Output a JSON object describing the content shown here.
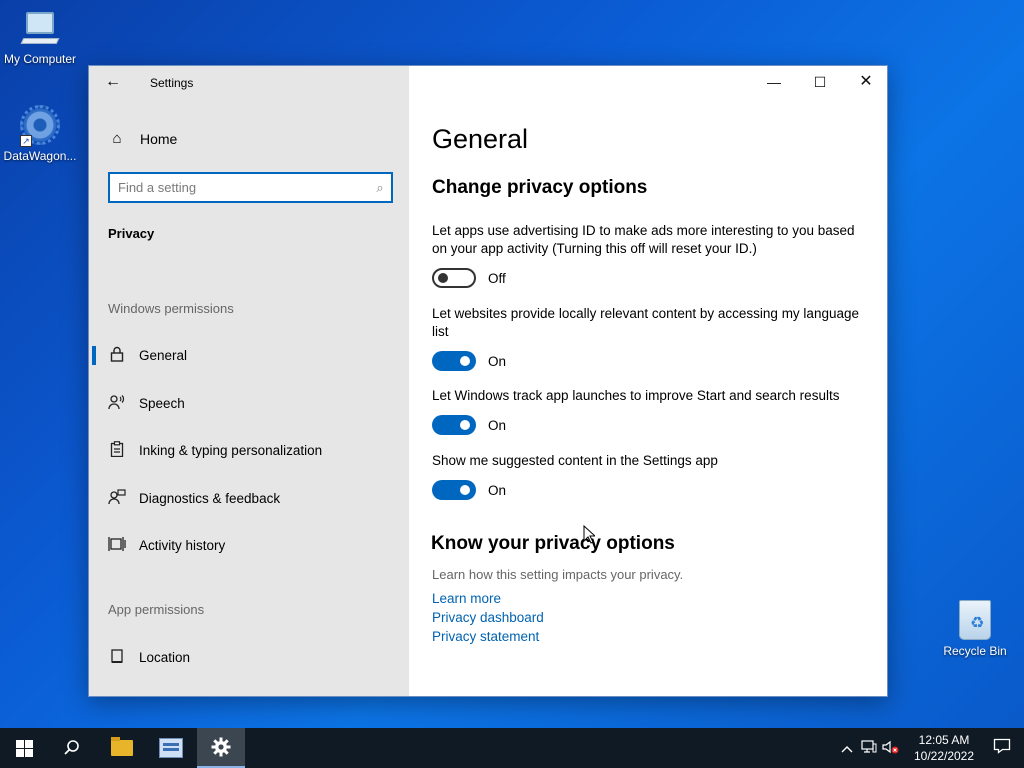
{
  "desktop": {
    "icons": [
      {
        "label": "My Computer"
      },
      {
        "label": "DataWagon..."
      },
      {
        "label": "Recycle Bin"
      }
    ]
  },
  "window": {
    "title": "Settings",
    "back_icon": "←",
    "minimize_icon": "—",
    "maximize_icon": "☐",
    "close_icon": "✕"
  },
  "sidebar": {
    "home_label": "Home",
    "home_icon": "⌂",
    "search_placeholder": "Find a setting",
    "search_icon": "⌕",
    "section_title": "Privacy",
    "group_windows": "Windows permissions",
    "group_app": "App permissions",
    "items": [
      {
        "label": "General",
        "icon": "🔒",
        "selected": true
      },
      {
        "label": "Speech",
        "icon": "⚇"
      },
      {
        "label": "Inking & typing personalization",
        "icon": "✎"
      },
      {
        "label": "Diagnostics & feedback",
        "icon": "⚇"
      },
      {
        "label": "Activity history",
        "icon": "▤"
      },
      {
        "label": "Location",
        "icon": "⌖"
      }
    ]
  },
  "content": {
    "page_title": "General",
    "sub_title": "Change privacy options",
    "settings": [
      {
        "desc": "Let apps use advertising ID to make ads more interesting to you based on your app activity (Turning this off will reset your ID.)",
        "state": "Off"
      },
      {
        "desc": "Let websites provide locally relevant content by accessing my language list",
        "state": "On"
      },
      {
        "desc": "Let Windows track app launches to improve Start and search results",
        "state": "On"
      },
      {
        "desc": "Show me suggested content in the Settings app",
        "state": "On"
      }
    ],
    "know_title": "Know your privacy options",
    "know_desc": "Learn how this setting impacts your privacy.",
    "links": [
      "Learn more",
      "Privacy dashboard",
      "Privacy statement"
    ]
  },
  "taskbar": {
    "time": "12:05 AM",
    "date": "10/22/2022",
    "tray_icons": [
      "chevron-up-icon",
      "network-icon",
      "volume-muted-icon"
    ],
    "accent": "#0067c0"
  }
}
